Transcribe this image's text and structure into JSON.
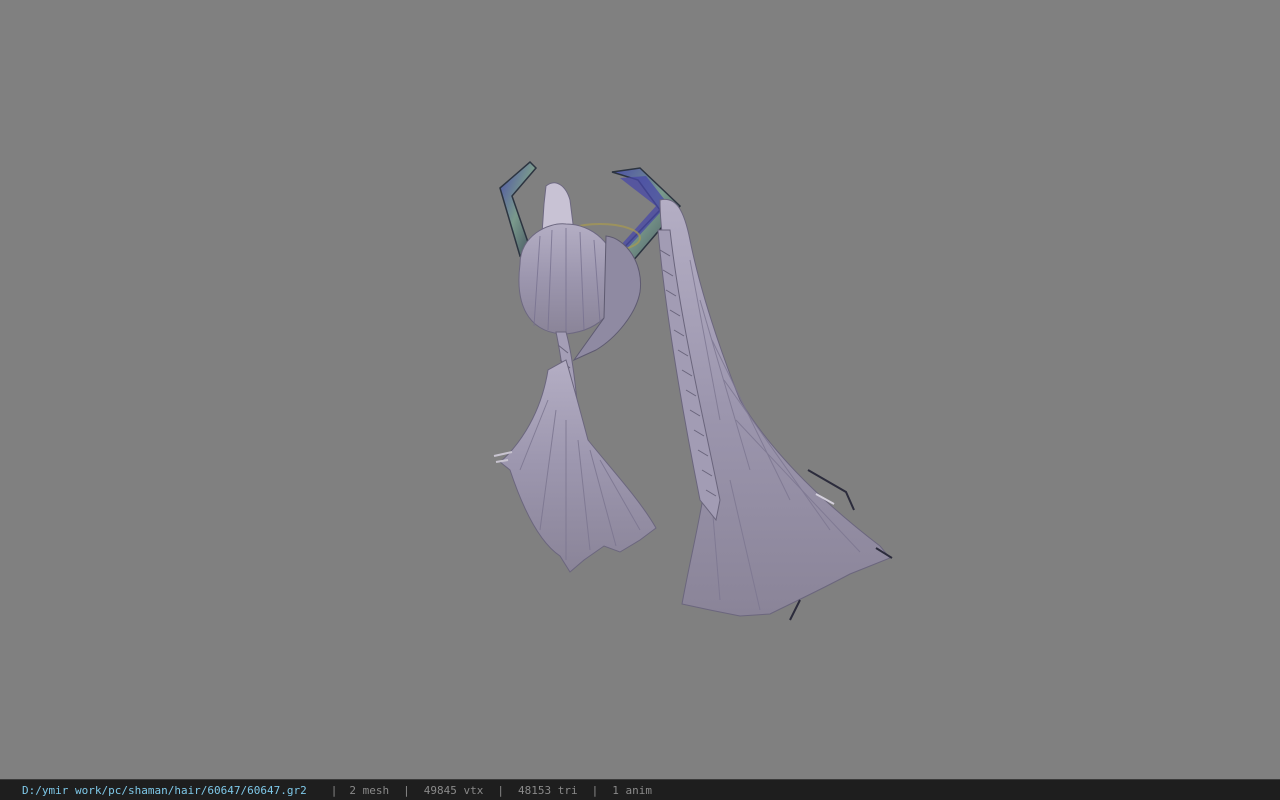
{
  "viewer": {
    "background_color": "#808080",
    "model": {
      "icon": "hair-model-icon",
      "hair_color": "#9b95ad",
      "ornament_color": "#6a8a7a",
      "accent_color": "#5050a0"
    }
  },
  "statusbar": {
    "file_path": "D:/ymir work/pc/shaman/hair/60647/60647.gr2",
    "separator": "|",
    "mesh_count": "2 mesh",
    "vertex_count": "49845 vtx",
    "triangle_count": "48153 tri",
    "anim_count": "1 anim",
    "path_color": "#7ec8e8",
    "text_color": "#8a8a8a"
  }
}
